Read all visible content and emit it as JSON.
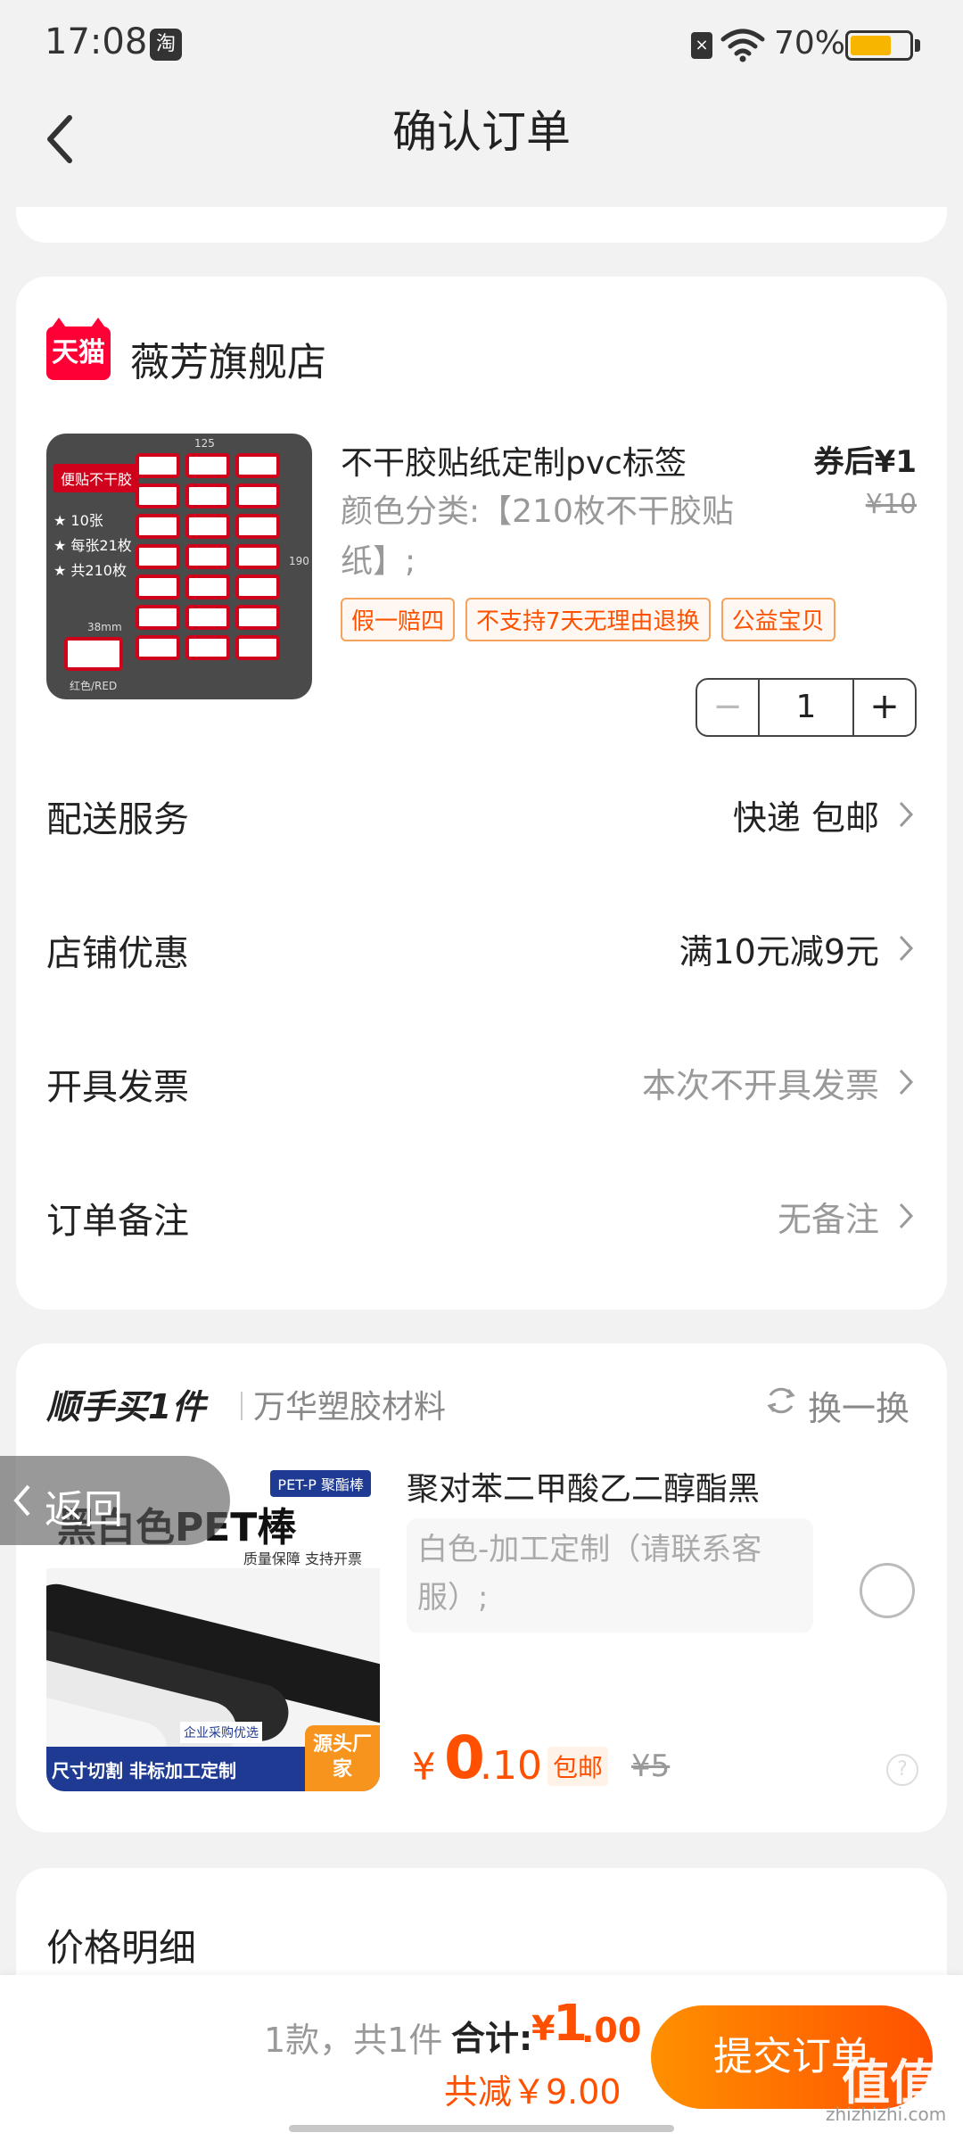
{
  "status_bar": {
    "time": "17:08",
    "app_icon_glyph": "淘",
    "battery": "70%",
    "battery_level": 0.7
  },
  "nav": {
    "title": "确认订单"
  },
  "shop": {
    "name": "薇芳旗舰店",
    "logo_text": "天猫",
    "product": {
      "title": "不干胶贴纸定制pvc标签",
      "coupon_price": "券后¥1",
      "original_price": "¥10",
      "spec": "颜色分类:【210枚不干胶贴纸】;",
      "tags": [
        "假一赔四",
        "不支持7天无理由退换",
        "公益宝贝"
      ],
      "quantity": "1",
      "image_text": {
        "tag": "便贴不干胶",
        "lines": [
          "★ 10张",
          "★ 每张21枚",
          "★ 共210枚"
        ],
        "width_label": "125",
        "height_label": "190",
        "small_label": "38mm",
        "color_label": "红色/RED"
      }
    },
    "rows": [
      {
        "label": "配送服务",
        "value": "快递 包邮",
        "muted": false
      },
      {
        "label": "店铺优惠",
        "value": "满10元减9元",
        "muted": false
      },
      {
        "label": "开具发票",
        "value": "本次不开具发票",
        "muted": true
      },
      {
        "label": "订单备注",
        "value": "无备注",
        "muted": true
      }
    ]
  },
  "addon": {
    "title": "顺手买1件",
    "shop": "万华塑胶材料",
    "swap_label": "换一换",
    "product_name": "聚对苯二甲酸乙二醇酯黑",
    "spec": "白色-加工定制（请联系客服）;",
    "price_currency": "¥",
    "price_int": "0",
    "price_dec": ".10",
    "free_shipping": "包邮",
    "original_price": "¥5",
    "image_text": {
      "badge": "PET-P 聚酯棒",
      "headline": "黑白色PET棒",
      "sub": "质量保障 支持开票",
      "ribbon_top": "企业采购优选",
      "bottom": "尺寸切割 非标加工定制",
      "corner": "源头厂家"
    }
  },
  "return_overlay": {
    "label": "返回"
  },
  "price_detail": {
    "heading": "价格明细"
  },
  "bottom_bar": {
    "count": "1款，共1件",
    "total_label": "合计:",
    "total_currency": "¥",
    "total_int": "1",
    "total_dec": ".00",
    "saved": "共减￥9.00",
    "submit": "提交订单"
  },
  "watermark": {
    "logo": "值值值",
    "url": "zhizhizhi.com"
  },
  "colors": {
    "accent": "#ff5000",
    "tmall_red": "#ff0036",
    "background": "#f2f2f2"
  }
}
